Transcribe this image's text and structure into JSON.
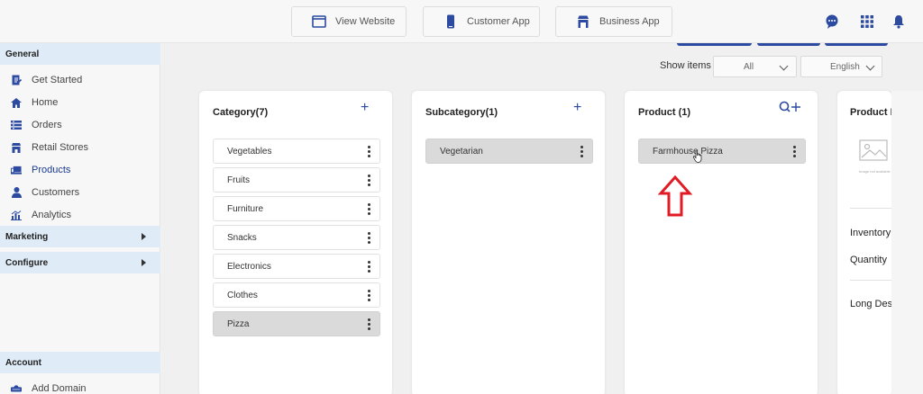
{
  "top_buttons": [
    {
      "label": "View Website",
      "icon": "browser-window-icon"
    },
    {
      "label": "Customer App",
      "icon": "mobile-phone-icon"
    },
    {
      "label": "Business App",
      "icon": "storefront-icon"
    }
  ],
  "top_icons": [
    "support-chat-icon",
    "apps-grid-icon",
    "notification-bell-icon"
  ],
  "sidebar": {
    "general_label": "General",
    "items": [
      {
        "label": "Get Started",
        "icon": "document-edit-icon"
      },
      {
        "label": "Home",
        "icon": "home-icon"
      },
      {
        "label": "Orders",
        "icon": "orders-list-icon"
      },
      {
        "label": "Retail Stores",
        "icon": "store-icon"
      },
      {
        "label": "Products",
        "icon": "products-laptop-icon",
        "active": true
      },
      {
        "label": "Customers",
        "icon": "user-icon"
      },
      {
        "label": "Analytics",
        "icon": "bar-chart-icon"
      }
    ],
    "marketing_label": "Marketing",
    "configure_label": "Configure",
    "account_label": "Account",
    "account_items": [
      {
        "label": "Add Domain",
        "icon": "domain-icon"
      }
    ]
  },
  "filters": {
    "show_items_label": "Show items",
    "show_items_value": "All",
    "language_value": "English"
  },
  "panels": {
    "category": {
      "title": "Category(7)",
      "items": [
        "Vegetables",
        "Fruits",
        "Furniture",
        "Snacks",
        "Electronics",
        "Clothes",
        "Pizza"
      ],
      "selected_index": 6
    },
    "subcategory": {
      "title": "Subcategory(1)",
      "items": [
        "Vegetarian"
      ],
      "selected_index": 0
    },
    "product": {
      "title": "Product (1)",
      "items": [
        "Farmhouse Pizza"
      ],
      "selected_index": 0
    },
    "product_detail": {
      "title": "Product I",
      "image_caption": "Image not available",
      "labels": [
        "Inventory",
        "Quantity",
        "Long Des"
      ]
    }
  },
  "colors": {
    "accent": "#2b4aa0",
    "annotation_arrow": "#e01b24",
    "section_header_bg": "#dfecf7"
  }
}
